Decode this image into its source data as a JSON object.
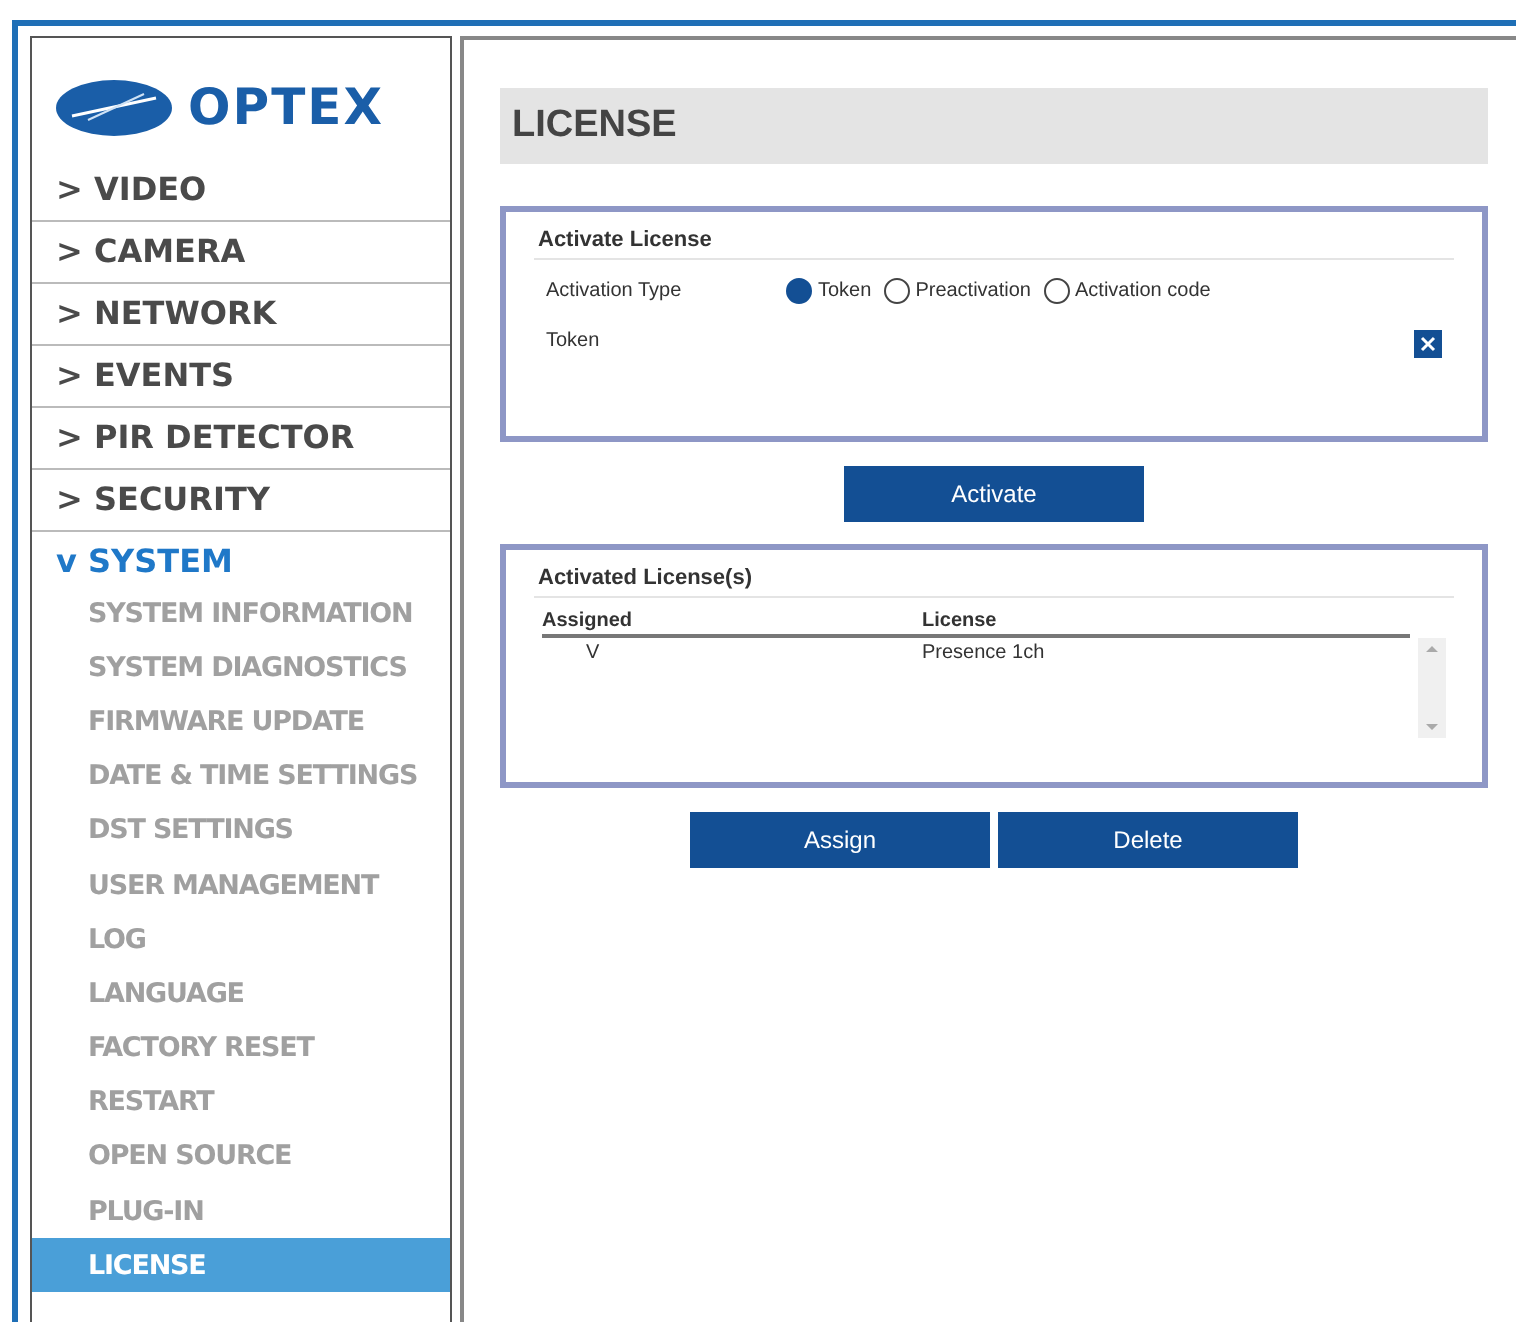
{
  "logo": {
    "text": "OPTEX"
  },
  "sidebar": {
    "items": [
      {
        "marker": ">",
        "label": "VIDEO",
        "expanded": false
      },
      {
        "marker": ">",
        "label": "CAMERA",
        "expanded": false
      },
      {
        "marker": ">",
        "label": "NETWORK",
        "expanded": false
      },
      {
        "marker": ">",
        "label": "EVENTS",
        "expanded": false
      },
      {
        "marker": ">",
        "label": "PIR DETECTOR",
        "expanded": false
      },
      {
        "marker": ">",
        "label": "SECURITY",
        "expanded": false
      },
      {
        "marker": "v",
        "label": "SYSTEM",
        "expanded": true,
        "children": [
          {
            "label": "SYSTEM INFORMATION",
            "selected": false
          },
          {
            "label": "SYSTEM DIAGNOSTICS",
            "selected": false
          },
          {
            "label": "FIRMWARE UPDATE",
            "selected": false
          },
          {
            "label": "DATE & TIME SETTINGS",
            "selected": false
          },
          {
            "label": "DST SETTINGS",
            "selected": false
          },
          {
            "label": "USER MANAGEMENT",
            "selected": false
          },
          {
            "label": "LOG",
            "selected": false
          },
          {
            "label": "LANGUAGE",
            "selected": false
          },
          {
            "label": "FACTORY RESET",
            "selected": false
          },
          {
            "label": "RESTART",
            "selected": false
          },
          {
            "label": "OPEN SOURCE",
            "selected": false
          },
          {
            "label": "PLUG-IN",
            "selected": false
          },
          {
            "label": "LICENSE",
            "selected": true
          }
        ]
      }
    ]
  },
  "page": {
    "title": "LICENSE",
    "activate_panel": {
      "title": "Activate License",
      "type_label": "Activation Type",
      "options": [
        {
          "label": "Token",
          "selected": true
        },
        {
          "label": "Preactivation",
          "selected": false
        },
        {
          "label": "Activation code",
          "selected": false
        }
      ],
      "token_label": "Token"
    },
    "activate_button": "Activate",
    "licenses_panel": {
      "title": "Activated License(s)",
      "columns": [
        "Assigned",
        "License"
      ],
      "rows": [
        [
          "V",
          "Presence 1ch"
        ]
      ]
    },
    "buttons": [
      "Assign",
      "Delete"
    ]
  }
}
